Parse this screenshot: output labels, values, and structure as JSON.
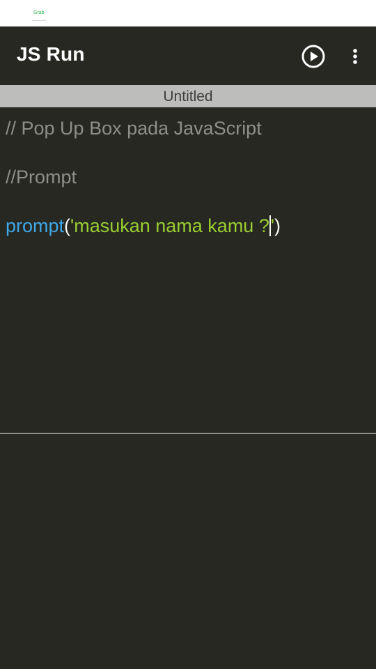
{
  "status_bar": {
    "logo_text": "Grab"
  },
  "app_bar": {
    "title": "JS Run",
    "run_icon": "play-circle-icon",
    "more_icon": "more-vert-icon"
  },
  "file_tab": {
    "name": "Untitled"
  },
  "editor": {
    "lines": [
      "// Pop Up Box pada JavaScript",
      "//Prompt",
      "prompt",
      "(",
      "'masukan nama kamu ?",
      "'",
      ")"
    ]
  },
  "console": {
    "output": ""
  },
  "colors": {
    "background": "#272822",
    "tab": "#bdbdbb",
    "comment": "#8f8f8a",
    "function": "#3ea8e8",
    "string": "#9acd32",
    "text": "#f8f8f2"
  }
}
